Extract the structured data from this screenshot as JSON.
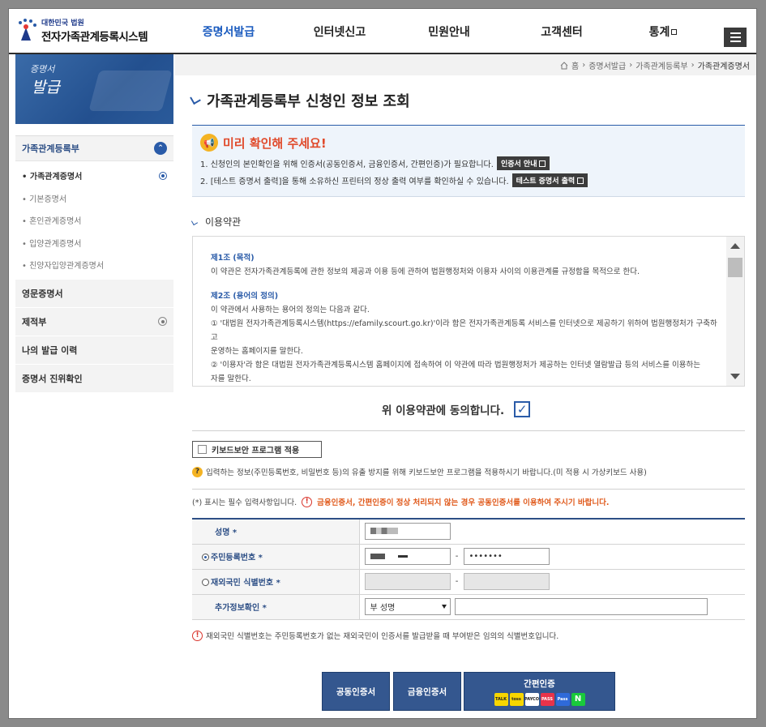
{
  "header": {
    "logo_small": "대한민국 법원",
    "logo_big": "전자가족관계등록시스템",
    "gnb": [
      {
        "label": "증명서발급",
        "active": true
      },
      {
        "label": "인터넷신고",
        "active": false
      },
      {
        "label": "민원안내",
        "active": false
      },
      {
        "label": "고객센터",
        "active": false
      },
      {
        "label": "통계",
        "active": false
      }
    ]
  },
  "breadcrumb": [
    "홈",
    "증명서발급",
    "가족관계등록부",
    "가족관계증명서"
  ],
  "side_banner": {
    "line1": "증명서",
    "line2": "발급"
  },
  "sidebar": {
    "section": "가족관계등록부",
    "sub_items": [
      "가족관계증명서",
      "기본증명서",
      "혼인관계증명서",
      "입양관계증명서",
      "친양자입양관계증명서"
    ],
    "rows": [
      "영문증명서",
      "제적부",
      "나의 발급 이력",
      "증명서 진위확인"
    ]
  },
  "page_title": "가족관계등록부 신청인 정보 조회",
  "notice": {
    "title": "미리 확인해 주세요!",
    "line1": "1. 신청인의 본인확인을 위해 인증서(공동인증서, 금융인증서, 간편인증)가 필요합니다.",
    "line1_btn": "인증서 안내",
    "line2": "2. [테스트 증명서 출력]을 통해 소유하신 프린터의 정상 출력 여부를 확인하실 수 있습니다.",
    "line2_btn": "테스트 증명서 출력"
  },
  "terms": {
    "label": "이용약관",
    "art1_title": "제1조 (목적)",
    "art1_body": "이 약관은 전자가족관계등록에 관한 정보의 제공과 이용 등에 관하여 법원행정처와 이용자 사이의 이용관계를 규정함을 목적으로 한다.",
    "art2_title": "제2조 (용어의 정의)",
    "art2_body": "이 약관에서 사용하는 용어의 정의는 다음과 같다.",
    "art2_1a": "① '대법원 전자가족관계등록시스템(https://efamily.scourt.go.kr)'이라 함은 전자가족관계등록 서비스를 인터넷으로 제공하기 위하여 법원행정처가 구축하고",
    "art2_1b": "운영하는 홈페이지를 말한다.",
    "art2_2a": "② '이용자'라 함은 대법원 전자가족관계등록시스템 홈페이지에 접속하여 이 약관에 따라 법원행정처가 제공하는 인터넷 열람발급 등의 서비스를 이용하는",
    "art2_2b": "자를 말한다."
  },
  "agree_label": "위 이용약관에 동의합니다.",
  "keyboard_btn": "키보드보안 프로그램 적용",
  "keyboard_help": "입력하는 정보(주민등록번호, 비밀번호 등)의 유출 방지를 위해 키보드보안 프로그램을 적용하시기 바랍니다.(미 적용 시 가상키보드 사용)",
  "required_note": "(*) 표시는 필수 입력사항입니다.",
  "required_warning": "금융인증서, 간편인증이 정상 처리되지 않는 경우 공동인증서를 이용하여 주시기 바랍니다.",
  "form": {
    "name_label": "성명 *",
    "rrn_label": "주민등록번호 *",
    "rrn_back": "•••••••",
    "foreign_label": "재외국민 식별번호 *",
    "extra_label": "추가정보확인 *",
    "extra_select": "부 성명"
  },
  "foot_note": "재외국민 식별번호는 주민등록번호가 없는 재외국민이 인증서를 발급받을 때 부여받은 임의의 식별번호입니다.",
  "buttons": {
    "joint": "공동인증서",
    "finance": "금융인증서",
    "simple": "간편인증"
  },
  "simple_apps": [
    {
      "name": "TALK",
      "color": "#f7d600"
    },
    {
      "name": "toss",
      "color": "#f7d600"
    },
    {
      "name": "PAYCO",
      "color": "#ffffff"
    },
    {
      "name": "PASS",
      "color": "#e8334a"
    },
    {
      "name": "Pass",
      "color": "#2f6ad9"
    },
    {
      "name": "N",
      "color": "#19c93b"
    }
  ]
}
